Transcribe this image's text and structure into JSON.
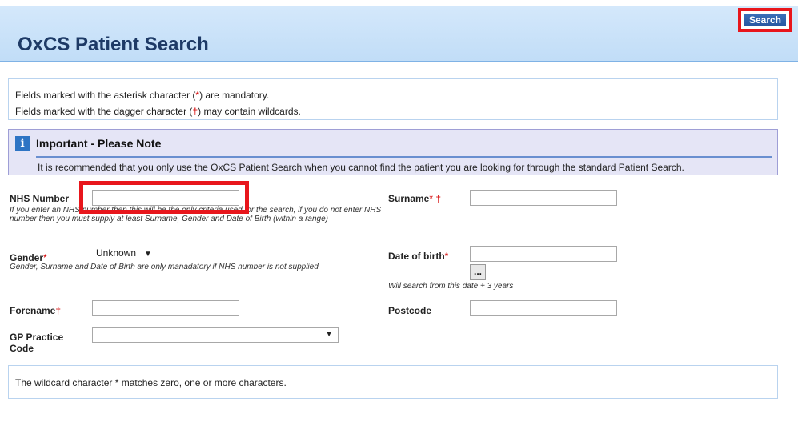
{
  "header": {
    "title": "OxCS Patient Search",
    "search_button": "Search"
  },
  "info": {
    "line1_a": "Fields marked with the asterisk character (",
    "line1_mark": "*",
    "line1_b": ") are mandatory.",
    "line2_a": "Fields marked with the dagger character (",
    "line2_mark": "†",
    "line2_b": ") may contain wildcards."
  },
  "note": {
    "icon": "i",
    "title": "Important - Please Note",
    "text": "It is recommended that you only use the OxCS Patient Search when you cannot find the patient you are looking for through the standard Patient Search."
  },
  "form": {
    "nhs_label": "NHS Number",
    "nhs_help": "If you enter an NHS number then this will be the only criteria used for the search, if you do not enter NHS number then you must supply at least Surname, Gender and Date of Birth (within a range)",
    "surname_label": "Surname",
    "surname_marks": "* †",
    "gender_label": "Gender",
    "gender_mark": "*",
    "gender_value": "Unknown",
    "gender_help": "Gender, Surname and Date of Birth are only manadatory if NHS number is not supplied",
    "dob_label": "Date of birth",
    "dob_mark": "*",
    "dob_picker": "...",
    "dob_help": "Will search from this date + 3 years",
    "forename_label": "Forename",
    "forename_mark": "†",
    "postcode_label": "Postcode",
    "gp_label": "GP Practice Code",
    "gp_value": ""
  },
  "footer": {
    "text": "The wildcard character * matches zero, one or more characters."
  },
  "icons": {
    "info": "info-icon",
    "dropdown": "chevron-down-icon"
  },
  "colors": {
    "accent": "#2d74c4",
    "highlight": "#e8161c",
    "mandatory": "#d40000"
  }
}
